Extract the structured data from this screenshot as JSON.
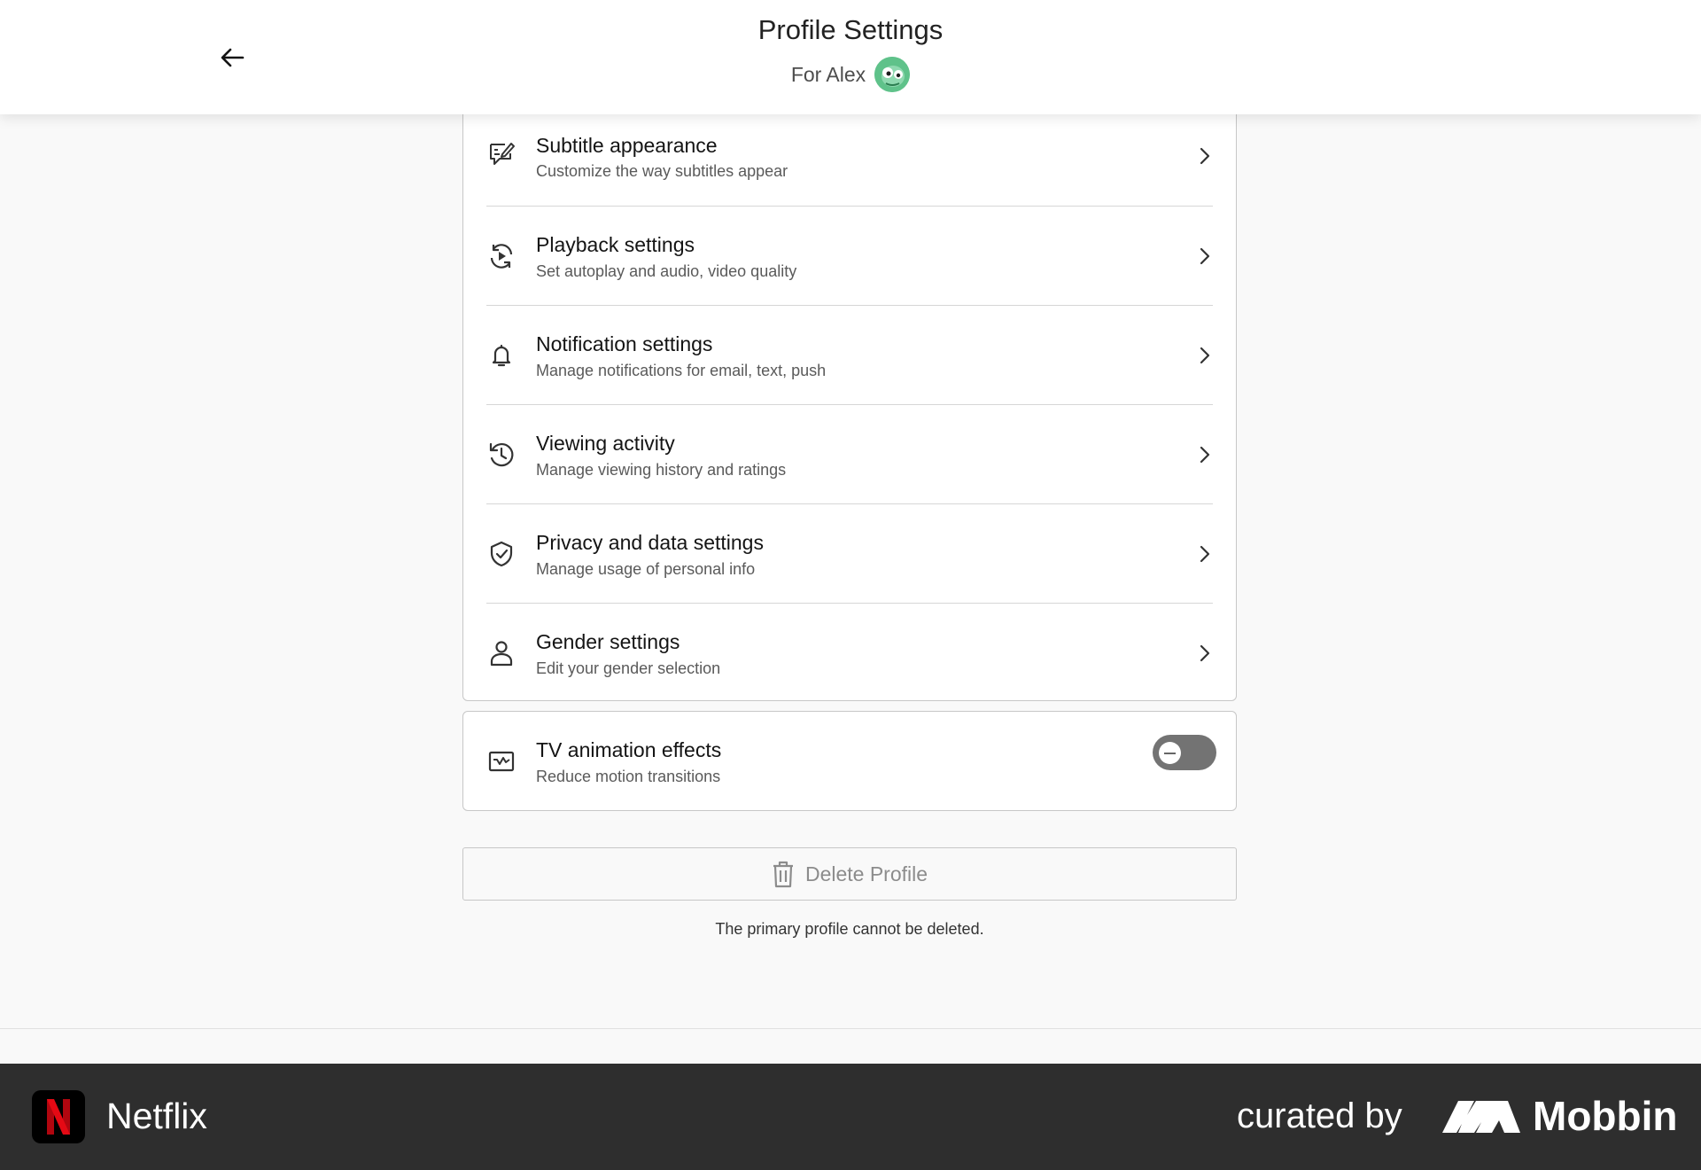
{
  "header": {
    "title": "Profile Settings",
    "for_label": "For Alex",
    "back_icon": "arrow-left-icon",
    "avatar_icon": "green-cartoon-avatar"
  },
  "settings": [
    {
      "title": "Subtitle appearance",
      "description": "Customize the way subtitles appear",
      "icon": "subtitle-edit-icon"
    },
    {
      "title": "Playback settings",
      "description": "Set autoplay and audio, video quality",
      "icon": "playback-refresh-icon"
    },
    {
      "title": "Notification settings",
      "description": "Manage notifications for email, text, push",
      "icon": "bell-icon"
    },
    {
      "title": "Viewing activity",
      "description": "Manage viewing history and ratings",
      "icon": "history-clock-icon"
    },
    {
      "title": "Privacy and data settings",
      "description": "Manage usage of personal info",
      "icon": "shield-check-icon"
    },
    {
      "title": "Gender settings",
      "description": "Edit your gender selection",
      "icon": "person-icon"
    }
  ],
  "tv_animation": {
    "title": "TV animation effects",
    "description": "Reduce motion transitions",
    "icon": "tv-icon",
    "enabled": false
  },
  "delete": {
    "label": "Delete Profile",
    "icon": "trash-icon",
    "note": "The primary profile cannot be deleted."
  },
  "footer": {
    "app_name": "Netflix",
    "curated_by": "curated by",
    "brand": "Mobbin"
  },
  "colors": {
    "background": "#f9f9f9",
    "footer": "#2e2e2e",
    "toggle_off": "#737373",
    "netflix_red": "#e50914"
  }
}
